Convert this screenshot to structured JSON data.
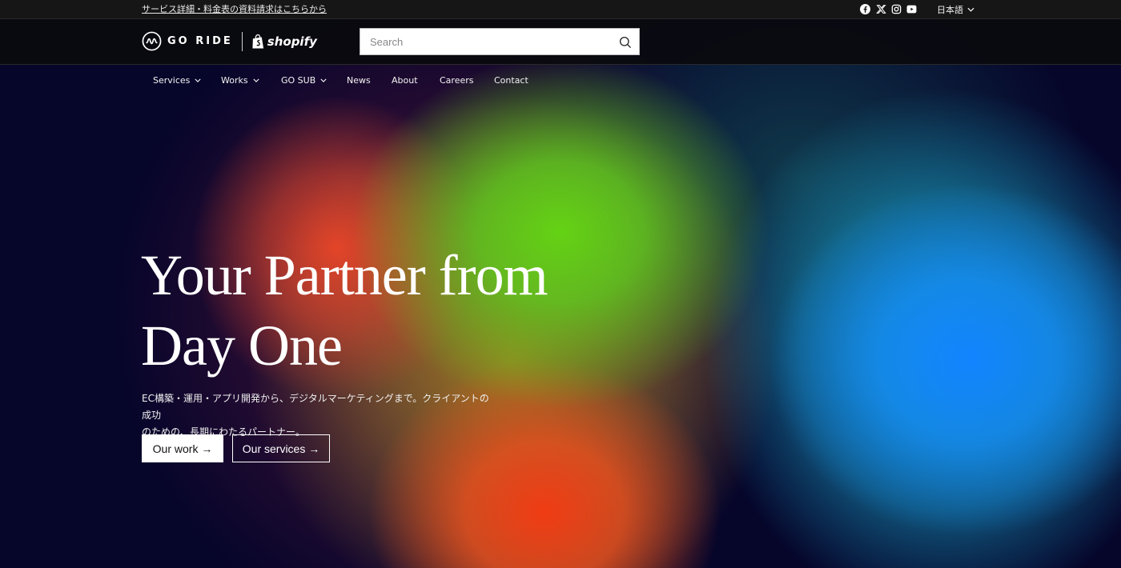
{
  "topbar": {
    "notice": "サービス詳細・料金表の資料請求はこちらから",
    "social": [
      {
        "icon": "facebook-icon"
      },
      {
        "icon": "x-icon"
      },
      {
        "icon": "instagram-icon"
      },
      {
        "icon": "youtube-icon"
      }
    ],
    "language": "日本語"
  },
  "header": {
    "brand": "GO RIDE",
    "partner": "shopify",
    "search_placeholder": "Search"
  },
  "nav": {
    "items": [
      {
        "label": "Services",
        "has_dropdown": true
      },
      {
        "label": "Works",
        "has_dropdown": true
      },
      {
        "label": "GO SUB",
        "has_dropdown": true
      },
      {
        "label": "News",
        "has_dropdown": false
      },
      {
        "label": "About",
        "has_dropdown": false
      },
      {
        "label": "Careers",
        "has_dropdown": false
      },
      {
        "label": "Contact",
        "has_dropdown": false
      }
    ]
  },
  "hero": {
    "title_line1": "Your Partner from",
    "title_line2": "Day One",
    "subtitle_line1": "EC構築・運用・アプリ開発から、デジタルマーケティングまで。クライアントの成功",
    "subtitle_line2": "のための、長期にわたるパートナー。",
    "primary_button": "Our work →",
    "secondary_button": "Our services →"
  },
  "colors": {
    "topbar_bg": "#161616",
    "header_bg": "#0a0a0e",
    "hero_base": "#06052a",
    "accent_green": "#64d214",
    "accent_blue": "#1284ff",
    "accent_red": "#f03c14"
  }
}
